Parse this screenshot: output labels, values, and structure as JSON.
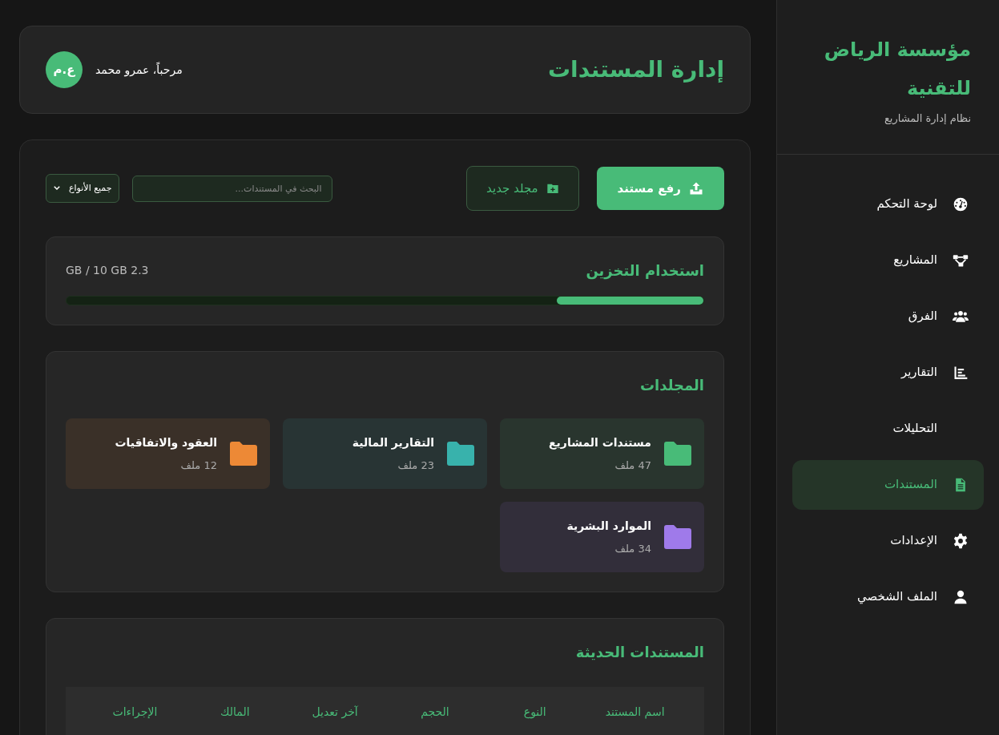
{
  "sidebar": {
    "title": "مؤسسة الرياض للتقنية",
    "subtitle": "نظام إدارة المشاريع",
    "items": [
      {
        "label": "لوحة التحكم",
        "selected": false
      },
      {
        "label": "المشاريع",
        "selected": false
      },
      {
        "label": "الفرق",
        "selected": false
      },
      {
        "label": "التقارير",
        "selected": false
      },
      {
        "label": "التحليلات",
        "selected": false
      },
      {
        "label": "المستندات",
        "selected": true
      },
      {
        "label": "الإعدادات",
        "selected": false
      },
      {
        "label": "الملف الشخصي",
        "selected": false
      }
    ]
  },
  "header": {
    "title": "إدارة المستندات",
    "greeting": "مرحباً، عمرو محمد",
    "avatar": "ع.م"
  },
  "toolbar": {
    "upload": "رفع مستند",
    "new_folder": "مجلد جديد",
    "search": {
      "placeholder": "البحث في المستندات..."
    },
    "filter": "جميع الأنواع"
  },
  "storage": {
    "title": "استخدام التخزين",
    "reading": "2.3 GB / 10 GB",
    "level": 0.23
  },
  "folders": {
    "title": "المجلدات",
    "items": [
      {
        "name": "مستندات المشاريع",
        "count": "47 ملف",
        "color": "#48bb78"
      },
      {
        "name": "التقارير المالية",
        "count": "23 ملف",
        "color": "#38b2ac"
      },
      {
        "name": "العقود والاتفاقيات",
        "count": "12 ملف",
        "color": "#ed8936"
      },
      {
        "name": "الموارد البشرية",
        "count": "34 ملف",
        "color": "#9f7aea"
      }
    ]
  },
  "recent": {
    "title": "المستندات الحديثة",
    "table": {
      "columns": [
        "اسم المستند",
        "النوع",
        "الحجم",
        "آخر تعديل",
        "المالك",
        "الإجراءات"
      ]
    }
  }
}
